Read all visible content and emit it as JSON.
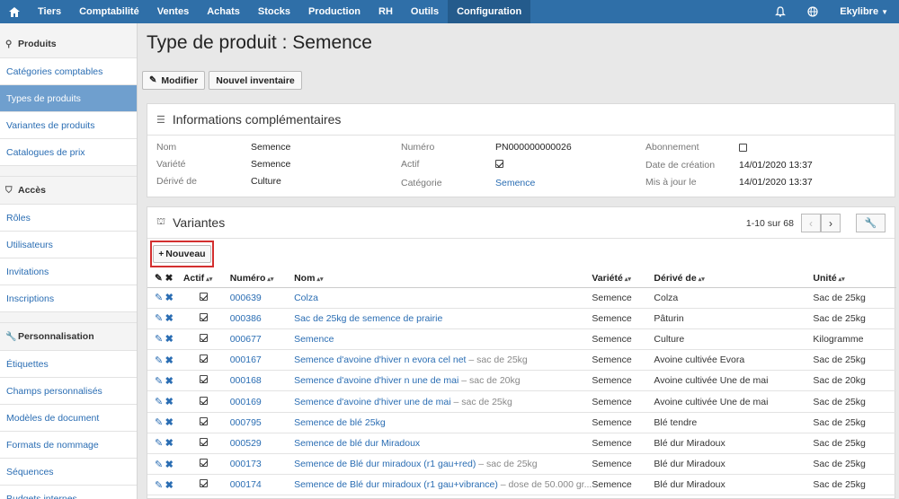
{
  "nav": {
    "home_icon": "home-icon",
    "items": [
      "Tiers",
      "Comptabilité",
      "Ventes",
      "Achats",
      "Stocks",
      "Production",
      "RH",
      "Outils",
      "Configuration"
    ],
    "active": "Configuration",
    "user": "Ekylibre",
    "bell_icon": "bell-icon",
    "globe_icon": "globe-icon"
  },
  "sidebar": {
    "produits": {
      "title": "Produits",
      "items": [
        "Catégories comptables",
        "Types de produits",
        "Variantes de produits",
        "Catalogues de prix"
      ]
    },
    "acces": {
      "title": "Accès",
      "items": [
        "Rôles",
        "Utilisateurs",
        "Invitations",
        "Inscriptions"
      ]
    },
    "perso": {
      "title": "Personnalisation",
      "items": [
        "Étiquettes",
        "Champs personnalisés",
        "Modèles de document",
        "Formats de nommage",
        "Séquences",
        "Budgets internes"
      ]
    }
  },
  "page": {
    "title": "Type de produit : Semence",
    "modify_label": "Modifier",
    "inventory_label": "Nouvel inventaire"
  },
  "info": {
    "title": "Informations complémentaires",
    "nom_label": "Nom",
    "nom": "Semence",
    "variete_label": "Variété",
    "variete": "Semence",
    "derive_label": "Dérivé de",
    "derive": "Culture",
    "numero_label": "Numéro",
    "numero": "PN000000000026",
    "actif_label": "Actif",
    "categorie_label": "Catégorie",
    "categorie": "Semence",
    "abonnement_label": "Abonnement",
    "creation_label": "Date de création",
    "creation": "14/01/2020 13:37",
    "maj_label": "Mis à jour le",
    "maj": "14/01/2020 13:37"
  },
  "variants": {
    "title": "Variantes",
    "pagination": "1-10 sur 68",
    "new_label": "Nouveau",
    "headers": {
      "actif": "Actif",
      "numero": "Numéro",
      "nom": "Nom",
      "variete": "Variété",
      "derive": "Dérivé de",
      "unite": "Unité"
    },
    "rows": [
      {
        "numero": "000639",
        "nom": "Colza",
        "nom_suffix": "",
        "variete": "Semence",
        "derive": "Colza",
        "unite": "Sac de 25kg"
      },
      {
        "numero": "000386",
        "nom": "Sac de 25kg de semence de prairie",
        "nom_suffix": "",
        "variete": "Semence",
        "derive": "Pâturin",
        "unite": "Sac de 25kg"
      },
      {
        "numero": "000677",
        "nom": "Semence",
        "nom_suffix": "",
        "variete": "Semence",
        "derive": "Culture",
        "unite": "Kilogramme"
      },
      {
        "numero": "000167",
        "nom": "Semence d'avoine d'hiver n evora cel net",
        "nom_suffix": "– sac de 25kg",
        "variete": "Semence",
        "derive": "Avoine cultivée Evora",
        "unite": "Sac de 25kg"
      },
      {
        "numero": "000168",
        "nom": "Semence d'avoine d'hiver n une de mai",
        "nom_suffix": "– sac de 20kg",
        "variete": "Semence",
        "derive": "Avoine cultivée Une de mai",
        "unite": "Sac de 20kg"
      },
      {
        "numero": "000169",
        "nom": "Semence d'avoine d'hiver une de mai",
        "nom_suffix": "– sac de 25kg",
        "variete": "Semence",
        "derive": "Avoine cultivée Une de mai",
        "unite": "Sac de 25kg"
      },
      {
        "numero": "000795",
        "nom": "Semence de blé 25kg",
        "nom_suffix": "",
        "variete": "Semence",
        "derive": "Blé tendre",
        "unite": "Sac de 25kg"
      },
      {
        "numero": "000529",
        "nom": "Semence de blé dur Miradoux",
        "nom_suffix": "",
        "variete": "Semence",
        "derive": "Blé dur Miradoux",
        "unite": "Sac de 25kg"
      },
      {
        "numero": "000173",
        "nom": "Semence de Blé dur miradoux (r1 gau+red)",
        "nom_suffix": "– sac de 25kg",
        "variete": "Semence",
        "derive": "Blé dur Miradoux",
        "unite": "Sac de 25kg"
      },
      {
        "numero": "000174",
        "nom": "Semence de Blé dur miradoux (r1 gau+vibrance)",
        "nom_suffix": "– dose de 50.000 gr...",
        "variete": "Semence",
        "derive": "Blé dur Miradoux",
        "unite": "Sac de 25kg"
      }
    ]
  }
}
